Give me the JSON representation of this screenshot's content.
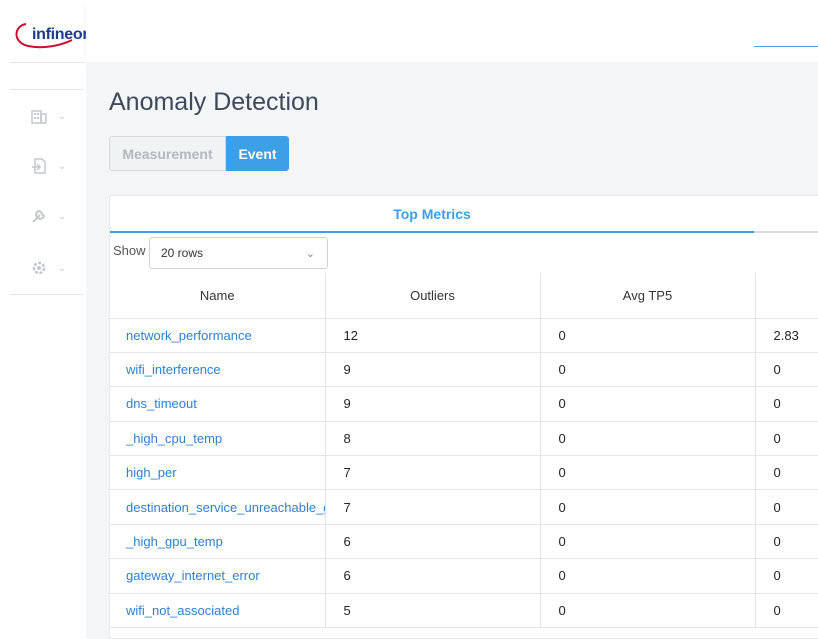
{
  "brand": {
    "logo_text": "infineon"
  },
  "sidebar": {
    "items": [
      {
        "icon": "building-icon"
      },
      {
        "icon": "document-export-icon"
      },
      {
        "icon": "wrench-icon"
      },
      {
        "icon": "gear-icon"
      }
    ]
  },
  "page": {
    "title": "Anomaly Detection",
    "toggle": {
      "measurement": "Measurement",
      "event": "Event",
      "active": "Event"
    },
    "tab": "Top Metrics",
    "show_label": "Show",
    "rows_select": "20 rows"
  },
  "table": {
    "columns": [
      "Name",
      "Outliers",
      "Avg TP5",
      ""
    ],
    "rows": [
      [
        "network_performance",
        "12",
        "0",
        "2.83"
      ],
      [
        "wifi_interference",
        "9",
        "0",
        "0"
      ],
      [
        "dns_timeout",
        "9",
        "0",
        "0"
      ],
      [
        "_high_cpu_temp",
        "8",
        "0",
        "0"
      ],
      [
        "high_per",
        "7",
        "0",
        "0"
      ],
      [
        "destination_service_unreachable_g",
        "7",
        "0",
        "0"
      ],
      [
        "_high_gpu_temp",
        "6",
        "0",
        "0"
      ],
      [
        "gateway_internet_error",
        "6",
        "0",
        "0"
      ],
      [
        "wifi_not_associated",
        "5",
        "0",
        "0"
      ]
    ]
  },
  "colors": {
    "accent": "#3d9fe6",
    "link": "#2f7fd1",
    "title": "#3c4a5c",
    "logo": "#1d3b8c",
    "logo_swoosh": "#c8102e"
  }
}
